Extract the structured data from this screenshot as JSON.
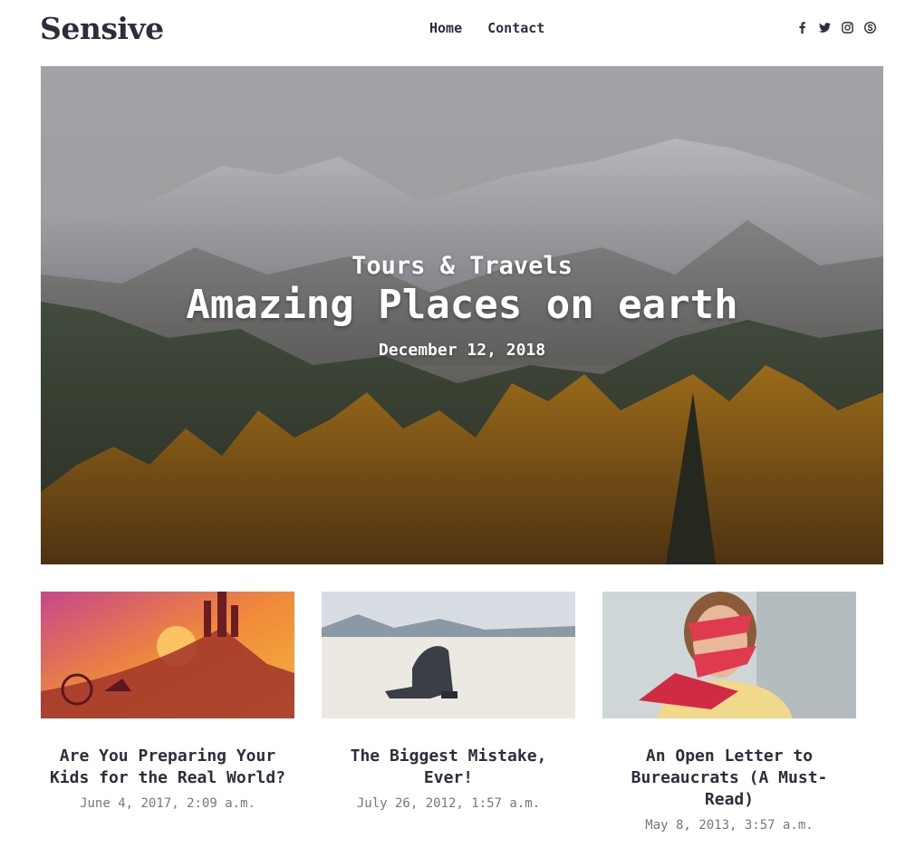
{
  "brand": {
    "name": "Sensive"
  },
  "nav": {
    "items": [
      {
        "label": "Home"
      },
      {
        "label": "Contact"
      }
    ]
  },
  "social": {
    "icons": [
      "facebook-icon",
      "twitter-icon",
      "instagram-icon",
      "skype-icon"
    ]
  },
  "hero": {
    "category": "Tours & Travels",
    "title": "Amazing Places on earth",
    "date": "December 12, 2018"
  },
  "posts": [
    {
      "title": "Are You Preparing Your Kids for the Real World?",
      "date": "June 4, 2017, 2:09 a.m."
    },
    {
      "title": "The Biggest Mistake, Ever!",
      "date": "July 26, 2012, 1:57 a.m."
    },
    {
      "title": "An Open Letter to Bureaucrats (A Must-Read)",
      "date": "May 8, 2013, 3:57 a.m."
    }
  ]
}
